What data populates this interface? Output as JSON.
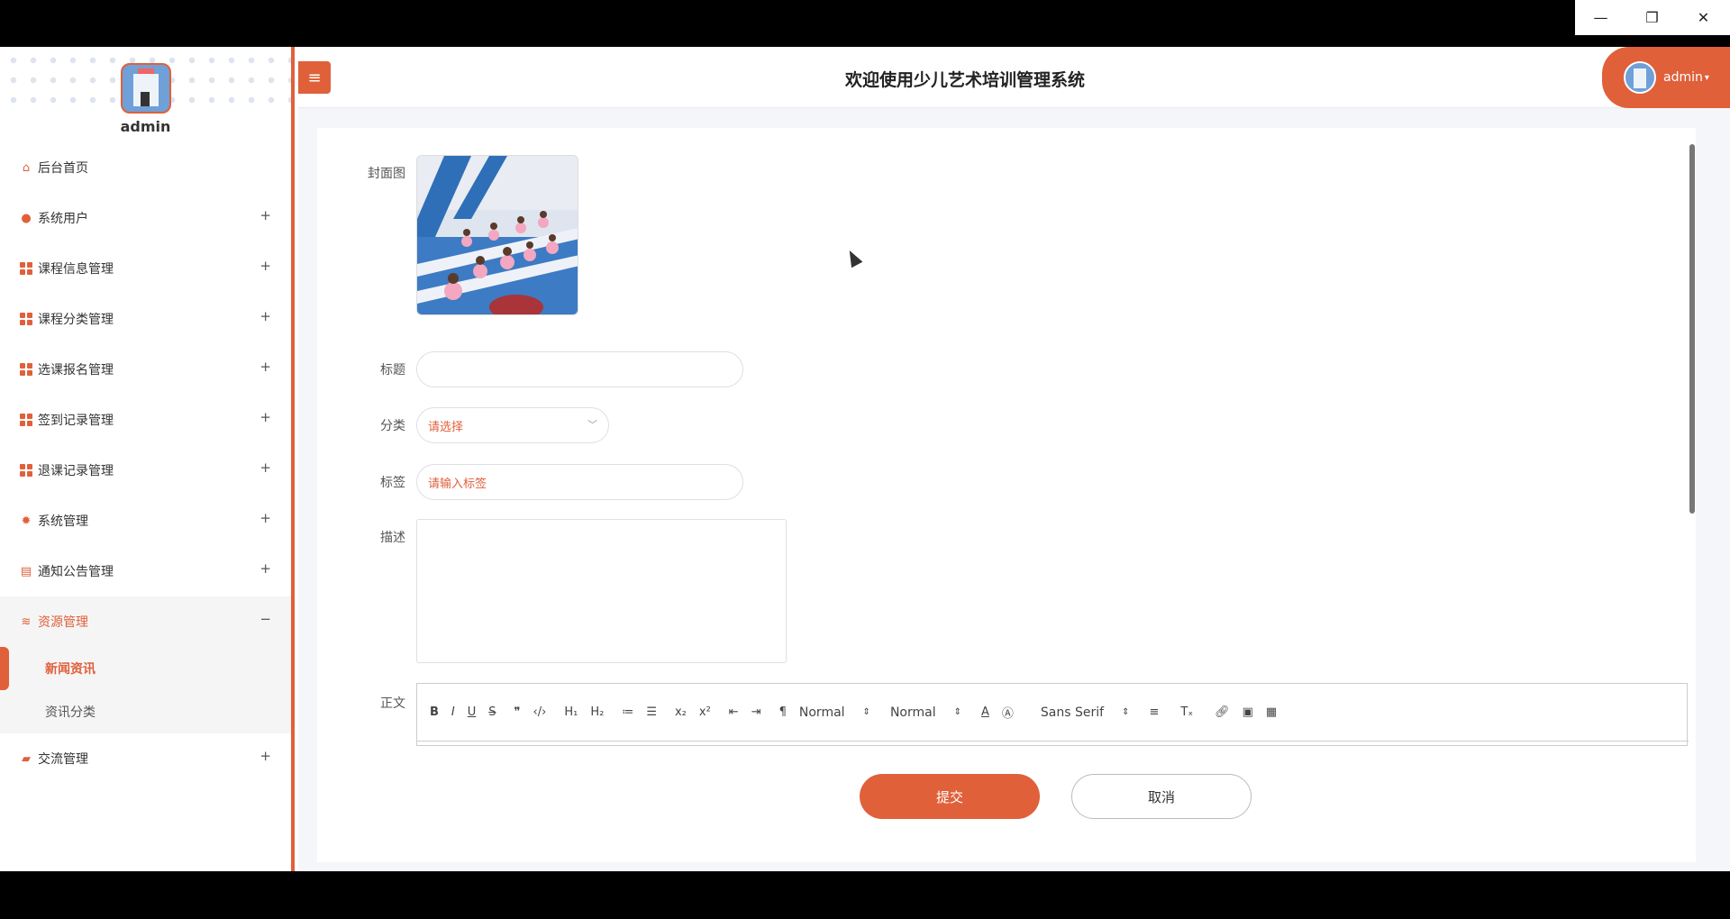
{
  "window": {
    "controls": [
      "—",
      "❐",
      "✕"
    ]
  },
  "sidebar": {
    "username": "admin",
    "items": [
      {
        "label": "后台首页",
        "icon": "home-icon"
      },
      {
        "label": "系统用户",
        "icon": "user-icon",
        "expand": "+"
      },
      {
        "label": "课程信息管理",
        "icon": "grid-icon",
        "expand": "+"
      },
      {
        "label": "课程分类管理",
        "icon": "grid-icon",
        "expand": "+"
      },
      {
        "label": "选课报名管理",
        "icon": "grid-icon",
        "expand": "+"
      },
      {
        "label": "签到记录管理",
        "icon": "grid-icon",
        "expand": "+"
      },
      {
        "label": "退课记录管理",
        "icon": "grid-icon",
        "expand": "+"
      },
      {
        "label": "系统管理",
        "icon": "gear-icon",
        "expand": "+"
      },
      {
        "label": "通知公告管理",
        "icon": "notice-icon",
        "expand": "+"
      },
      {
        "label": "资源管理",
        "icon": "database-icon",
        "expand": "−"
      }
    ],
    "subitems": [
      {
        "label": "新闻资讯",
        "active": true
      },
      {
        "label": "资讯分类",
        "active": false
      }
    ],
    "last_item": {
      "label": "交流管理",
      "icon": "chat-icon",
      "expand": "+"
    }
  },
  "header": {
    "title": "欢迎使用少儿艺术培训管理系统",
    "user": "admin"
  },
  "form": {
    "cover_label": "封面图",
    "title_label": "标题",
    "title_value": "",
    "category_label": "分类",
    "category_placeholder": "请选择",
    "tag_label": "标签",
    "tag_placeholder": "请输入标签",
    "desc_label": "描述",
    "body_label": "正文",
    "toolbar": {
      "size_select": "Normal",
      "header_select": "Normal",
      "font_select": "Sans Serif"
    },
    "submit": "提交",
    "cancel": "取消"
  },
  "colors": {
    "accent": "#e0603a"
  }
}
